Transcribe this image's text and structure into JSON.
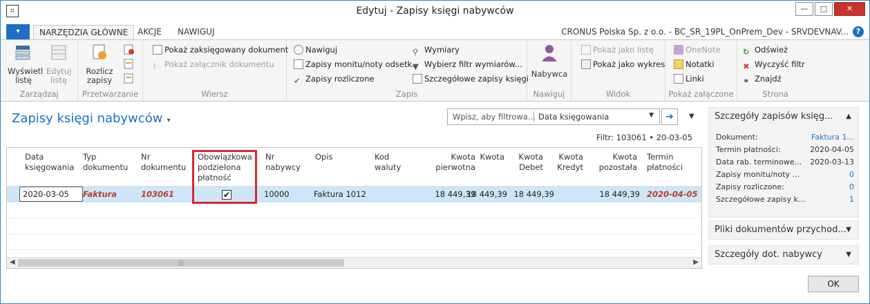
{
  "window": {
    "title": "Edytuj - Zapisy księgi nabywców",
    "buttons": {
      "minimize": "—",
      "maximize": "□",
      "close": "✕"
    }
  },
  "ribbon_tabs": {
    "file": "▾",
    "tabs": [
      "NARZĘDZIA GŁÓWNE",
      "AKCJE",
      "NAWIGUJ"
    ],
    "company": "CRONUS Polska Sp. z o.o. - BC_SR_19PL_OnPrem_Dev - SRVDEVNAV...",
    "help": "?"
  },
  "ribbon": {
    "zarzadzaj": {
      "title": "Zarządzaj",
      "show_list": "Wyświetl listę",
      "edit_list": "Edytuj listę"
    },
    "przetwarzanie": {
      "title": "Przetwarzanie",
      "apply": "Rozlicz zapisy"
    },
    "wiersz": {
      "title": "Wiersz",
      "show_posted": "Pokaż zaksięgowany dokument",
      "show_attachment": "Pokaż załącznik dokumentu"
    },
    "zapis": {
      "title": "Zapis",
      "navigate": "Nawiguj",
      "reminders": "Zapisy monitu/noty odsetk.",
      "applied": "Zapisy rozliczone",
      "dimensions": "Wymiary",
      "dim_filter": "Wybierz filtr wymiarów...",
      "detailed": "Szczegółowe zapisy księgi"
    },
    "nawiguj": {
      "title": "Nawiguj",
      "customer": "Nabywca"
    },
    "widok": {
      "title": "Widok",
      "as_list": "Pokaż jako listę",
      "as_chart": "Pokaż jako wykres"
    },
    "pokaz_zalacz": {
      "title": "Pokaż załączone",
      "onenote": "OneNote",
      "notes": "Notatki",
      "links": "Linki"
    },
    "strona": {
      "title": "Strona",
      "refresh": "Odśwież",
      "clear_filter": "Wyczyść filtr",
      "find": "Znajdź"
    }
  },
  "page": {
    "title": "Zapisy księgi nabywców",
    "search_placeholder": "Wpisz, aby filtrowa...",
    "filter_field": "Data księgowania",
    "filter_text": "Filtr: 103061 • 20-03-05"
  },
  "grid": {
    "headers": [
      "Data\nksięgowania",
      "Typ\ndokumentu",
      "Nr\ndokumentu",
      "Obowiązkowa\npodzielona\npłatność",
      "Nr\nnabywcy",
      "Opis",
      "Kod\nwaluty",
      "Kwota\npierwotna",
      "Kwota",
      "Kwota\nDebet",
      "Kwota\nKredyt",
      "Kwota\npozostała",
      "Termin\npłatności"
    ],
    "row": {
      "posting_date": "2020-03-05",
      "doc_type": "Faktura",
      "doc_no": "103061",
      "split_payment": true,
      "split_payment_mark": "✔",
      "customer_no": "10000",
      "description": "Faktura 1012",
      "currency": "",
      "original_amount": "18 449,39",
      "amount": "18 449,39",
      "debit": "18 449,39",
      "credit": "",
      "remaining": "18 449,39",
      "due_date": "2020-04-05"
    }
  },
  "factbox": {
    "details_title": "Szczegóły zapisów księg...",
    "details": [
      {
        "k": "Dokument:",
        "v": "Faktura 1...",
        "link": true
      },
      {
        "k": "Termin płatności:",
        "v": "2020-04-05",
        "link": false
      },
      {
        "k": "Data rab. terminowe...",
        "v": "2020-03-13",
        "link": false
      },
      {
        "k": "Zapisy monitu/noty ...",
        "v": "0",
        "link": true
      },
      {
        "k": "Zapisy rozliczone:",
        "v": "0",
        "link": true
      },
      {
        "k": "Szczegółowe zapisy k...",
        "v": "1",
        "link": true
      }
    ],
    "attachments_title": "Pliki dokumentów przychod...",
    "customer_title": "Szczegóły dot. nabywcy"
  },
  "ok_label": "OK"
}
